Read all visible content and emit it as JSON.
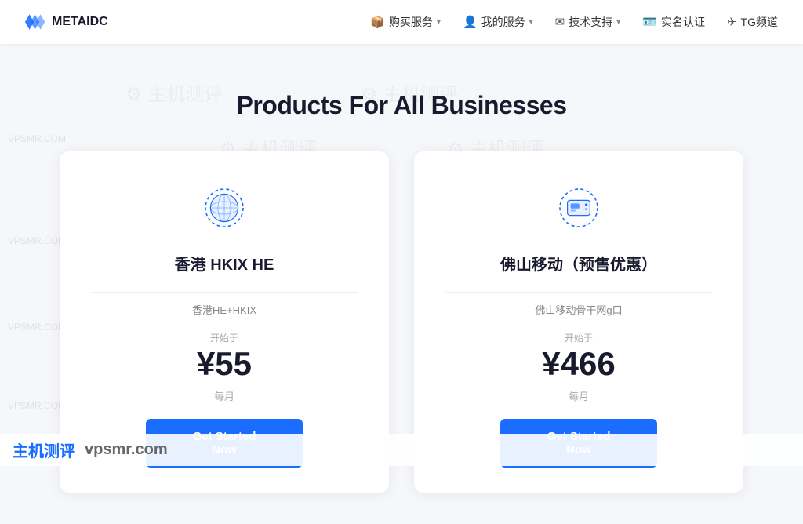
{
  "navbar": {
    "logo_text": "METAIDC",
    "nav_items": [
      {
        "id": "buy",
        "label": "购买服务",
        "has_dropdown": true,
        "icon": "box-icon"
      },
      {
        "id": "my-service",
        "label": "我的服务",
        "has_dropdown": true,
        "icon": "user-icon"
      },
      {
        "id": "support",
        "label": "技术支持",
        "has_dropdown": true,
        "icon": "mail-icon"
      },
      {
        "id": "realname",
        "label": "实名认证",
        "has_dropdown": false,
        "icon": "id-icon"
      },
      {
        "id": "tg",
        "label": "TG频道",
        "has_dropdown": false,
        "icon": "telegram-icon"
      }
    ]
  },
  "main": {
    "section_title": "Products For All Businesses",
    "cards": [
      {
        "id": "hk-hkix",
        "title": "香港 HKIX HE",
        "subtitle": "香港HE+HKIX",
        "price_label": "开始于",
        "price": "¥55",
        "period": "每月",
        "cta": "Get Started Now",
        "icon": "globe-icon"
      },
      {
        "id": "foshan-mobile",
        "title": "佛山移动（预售优惠）",
        "subtitle": "佛山移动骨干网g口",
        "price_label": "开始于",
        "price": "¥466",
        "period": "每月",
        "cta": "Get Started Now",
        "icon": "server-icon"
      }
    ]
  },
  "watermark": {
    "text1": "主机测评",
    "text2": "VPSMR.COM",
    "bottom_chinese": "主机测评",
    "bottom_english": "vpsmr.com"
  }
}
